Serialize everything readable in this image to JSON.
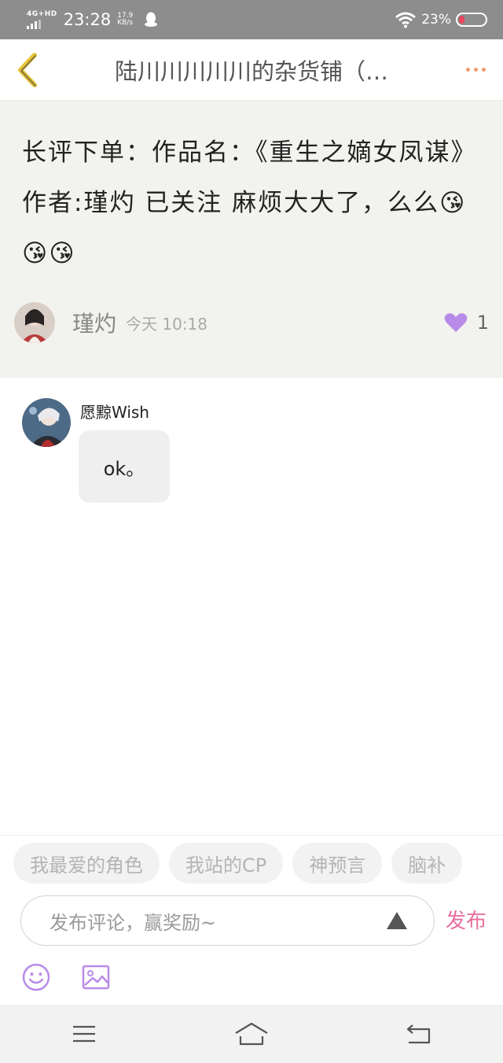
{
  "status_bar": {
    "network": "4G+HD",
    "time": "23:28",
    "speed_value": "17.9",
    "speed_unit": "KB/s",
    "battery": "23%",
    "battery_level": 0.23
  },
  "nav": {
    "title": "陆川川川川川的杂货铺（…"
  },
  "post": {
    "text": "长评下单：作品名：《重生之嫡女凤谋》 作者:瑾灼 已关注 麻烦大大了，么么😘😘😘",
    "author": "瑾灼",
    "time": "今天 10:18",
    "like_count": "1"
  },
  "comment": {
    "author": "愿黥Wish",
    "text": "ok。"
  },
  "tags": [
    "我最爱的角色",
    "我站的CP",
    "神预言",
    "脑补"
  ],
  "input": {
    "placeholder": "发布评论，赢奖励~",
    "publish_label": "发布"
  },
  "colors": {
    "accent_pink": "#e8709e",
    "heart_purple": "#b98be8",
    "more_dots": "#f39a6a"
  }
}
